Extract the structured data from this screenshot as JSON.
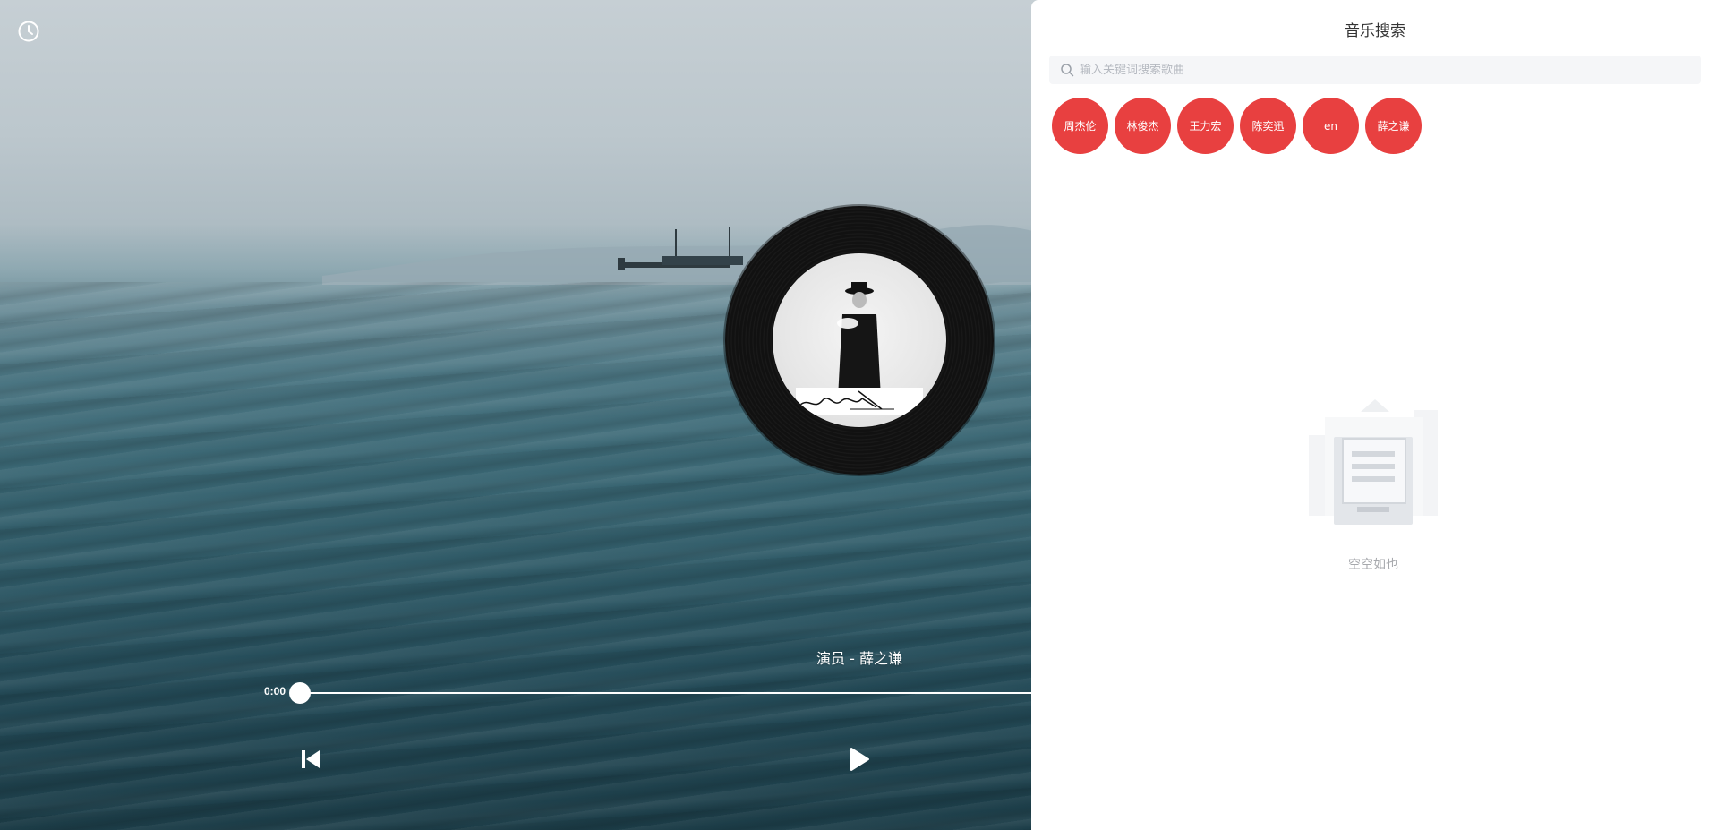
{
  "player": {
    "song_title": "演员 - 薛之谦",
    "current_time": "0:00",
    "progress": 0,
    "icons": {
      "history": "clock-icon",
      "prev": "skip-previous-icon",
      "play": "play-icon"
    }
  },
  "search_panel": {
    "title": "音乐搜索",
    "search_placeholder": "输入关键词搜索歌曲",
    "search_value": "",
    "tags": [
      "周杰伦",
      "林俊杰",
      "王力宏",
      "陈奕迅",
      "en",
      "薛之谦"
    ],
    "empty_text": "空空如也",
    "colors": {
      "tag_background": "#e84040"
    }
  }
}
